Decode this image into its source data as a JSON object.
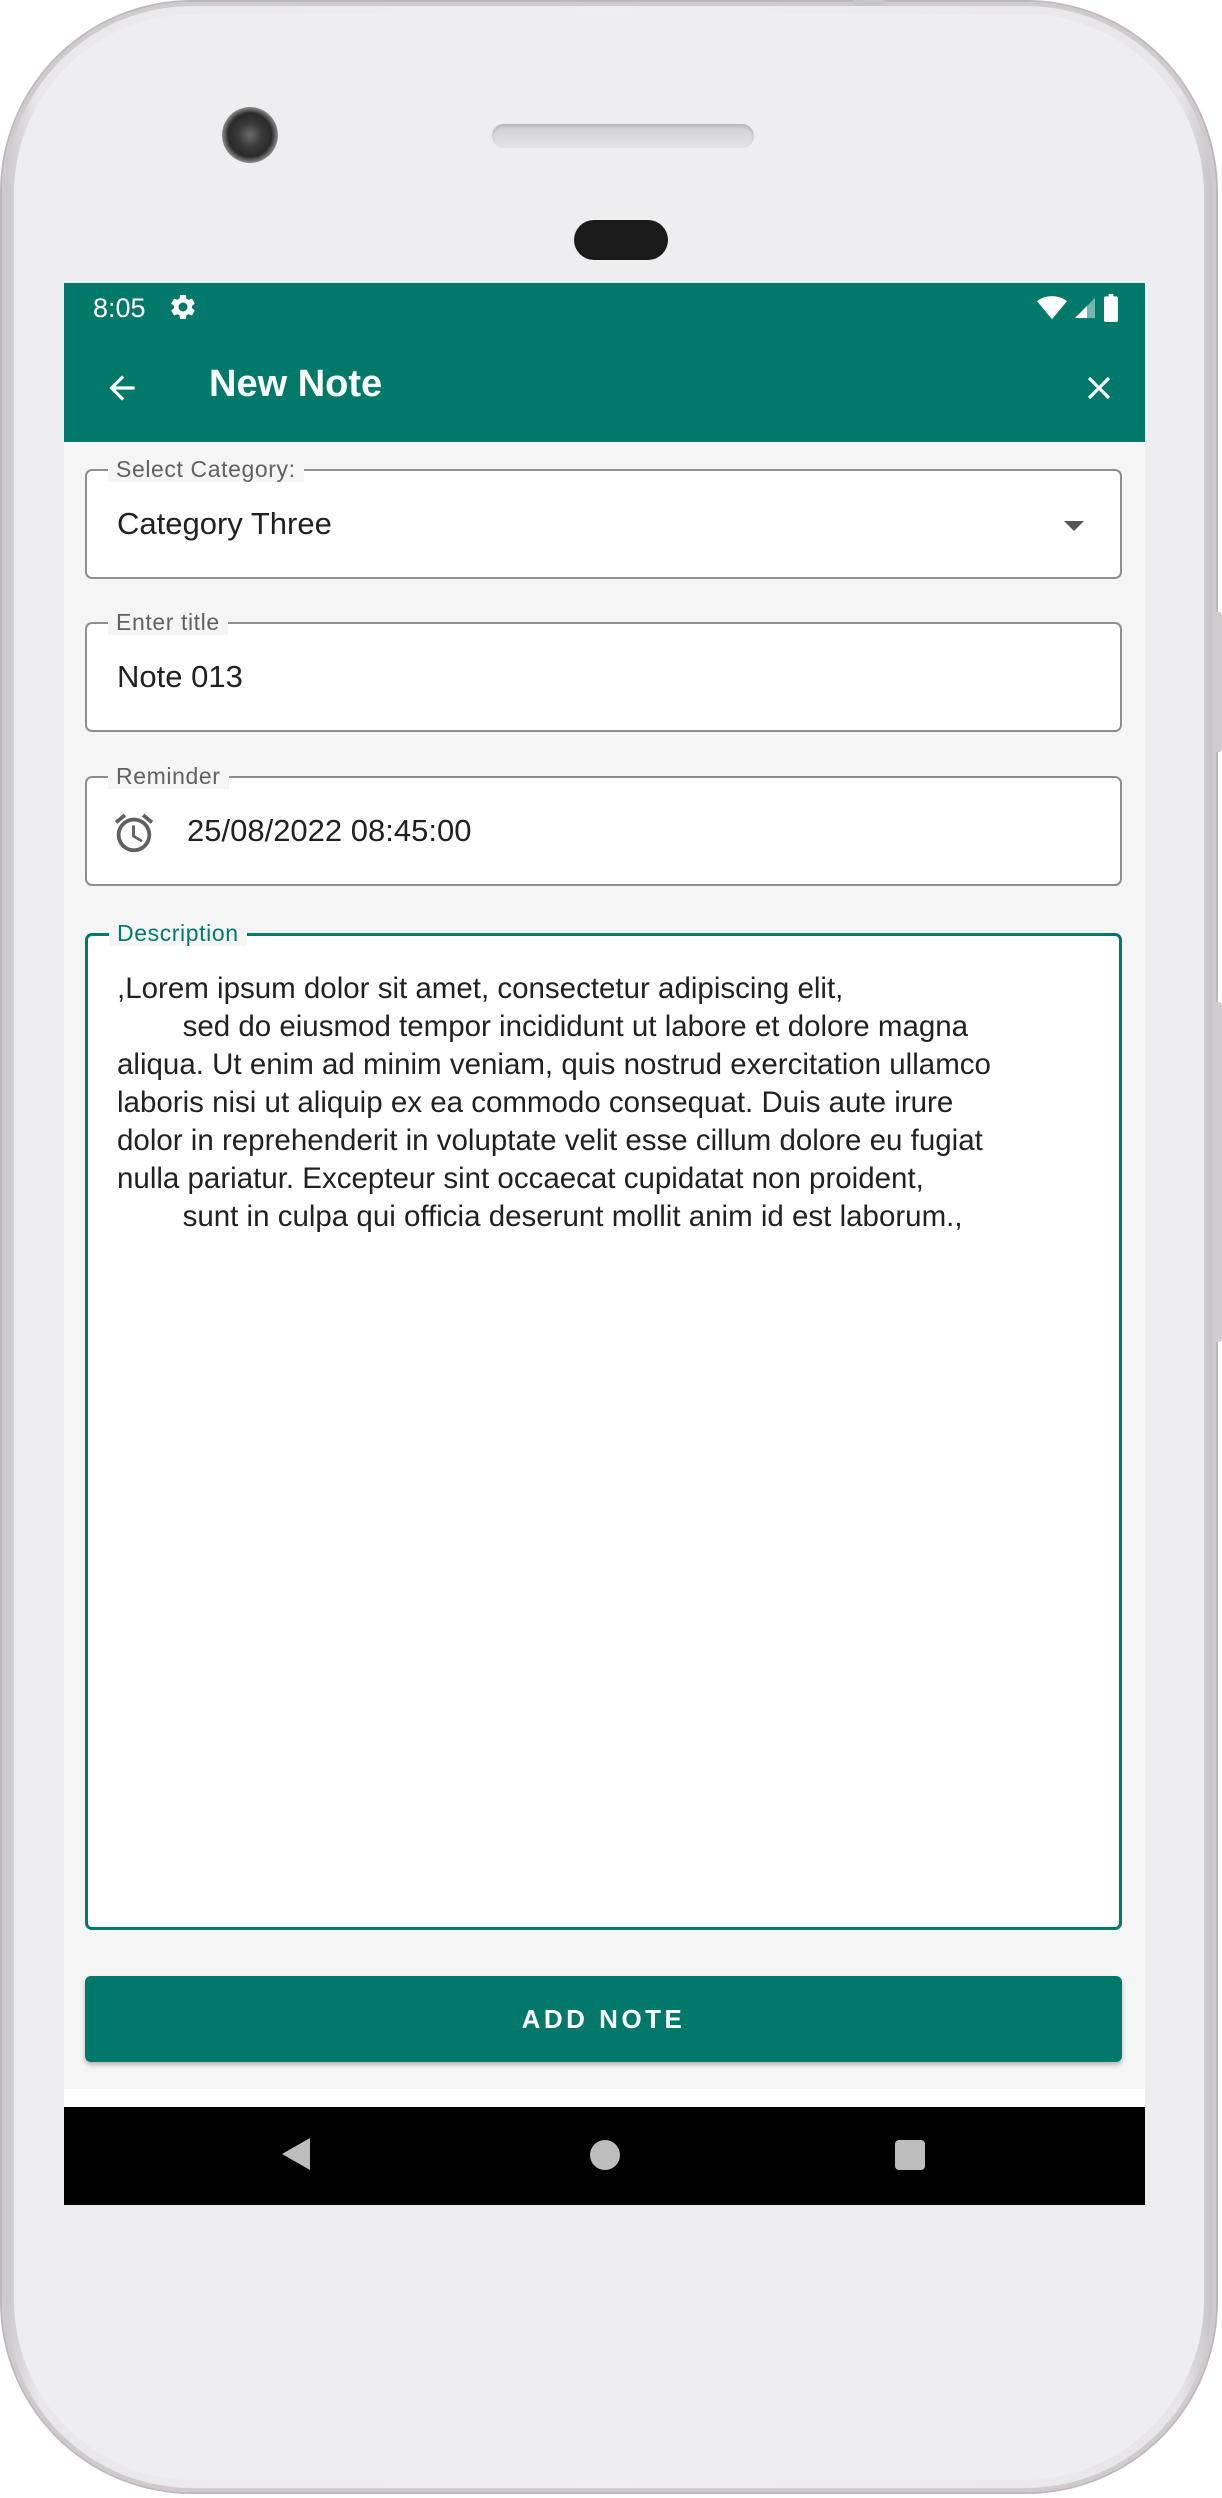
{
  "status_bar": {
    "time": "8:05",
    "icons": [
      "gear-icon",
      "wifi-icon",
      "signal-icon",
      "battery-icon"
    ]
  },
  "app_bar": {
    "title": "New Note",
    "back_icon": "arrow-back-icon",
    "close_icon": "close-icon"
  },
  "form": {
    "category": {
      "label": "Select Category:",
      "value": "Category Three"
    },
    "title": {
      "label": "Enter title",
      "value": "Note 013"
    },
    "reminder": {
      "label": "Reminder",
      "value": "25/08/2022 08:45:00",
      "icon": "alarm-clock-icon"
    },
    "description": {
      "label": "Description",
      "value": ",Lorem ipsum dolor sit amet, consectetur adipiscing elit,\n        sed do eiusmod tempor incididunt ut labore et dolore magna\naliqua. Ut enim ad minim veniam, quis nostrud exercitation ullamco\nlaboris nisi ut aliquip ex ea commodo consequat. Duis aute irure\ndolor in reprehenderit in voluptate velit esse cillum dolore eu fugiat\nnulla pariatur. Excepteur sint occaecat cupidatat non proident,\n        sunt in culpa qui officia deserunt mollit anim id est laborum.,"
    },
    "submit_label": "ADD NOTE"
  },
  "nav_bar": {
    "icons": [
      "nav-back-icon",
      "nav-home-icon",
      "nav-recents-icon"
    ]
  },
  "colors": {
    "primary": "#00796b",
    "text": "#212121",
    "label": "#616161",
    "background": "#f5f5f5"
  }
}
